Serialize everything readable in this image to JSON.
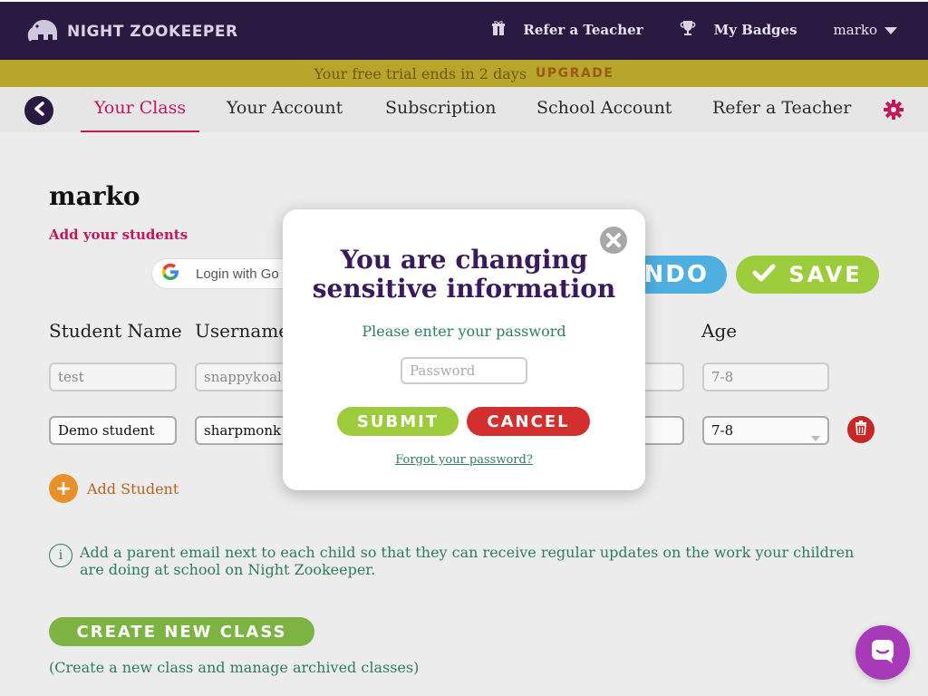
{
  "brand": {
    "name": "NIGHT ZOOKEEPER"
  },
  "topnav": {
    "refer_label": "Refer a Teacher",
    "badges_label": "My Badges",
    "user_name": "marko"
  },
  "trial": {
    "text": "Your free trial ends in 2 days",
    "upgrade_label": "UPGRADE"
  },
  "tabs": [
    {
      "label": "Your Class",
      "active": true
    },
    {
      "label": "Your Account"
    },
    {
      "label": "Subscription"
    },
    {
      "label": "School Account"
    },
    {
      "label": "Refer a Teacher"
    }
  ],
  "class_page": {
    "class_name": "marko",
    "add_students_label": "Add your students",
    "google_label": "Login with Go",
    "undo_label": "UNDO",
    "save_label": "SAVE",
    "columns": {
      "student_name": "Student Name",
      "username": "Username",
      "age": "Age"
    },
    "students": [
      {
        "name": "test",
        "username": "snappykoal",
        "age": "7-8"
      },
      {
        "name": "Demo student",
        "username": "sharpmonk",
        "age": "7-8"
      }
    ],
    "add_student_label": "Add Student",
    "info_text": "Add a parent email next to each child so that they can receive regular updates on the work your children are doing at school on Night Zookeeper.",
    "create_class_label": "CREATE NEW CLASS",
    "create_class_note": "(Create a new class and manage archived classes)"
  },
  "modal": {
    "title_line1": "You are changing",
    "title_line2": "sensitive information",
    "subtitle": "Please enter your password",
    "password_placeholder": "Password",
    "submit_label": "SUBMIT",
    "cancel_label": "CANCEL",
    "forgot_label": "Forgot your password?"
  },
  "colors": {
    "topbar": "#2a1a42",
    "accent_pink": "#c2185b",
    "banner": "#b8a52c",
    "submit_green": "#9ccb3b",
    "cancel_red": "#d32f2f",
    "chat_purple": "#a63ab8"
  }
}
